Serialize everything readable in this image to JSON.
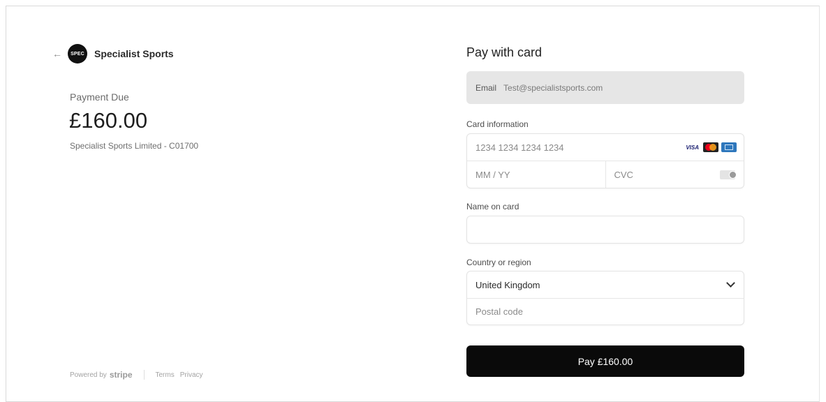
{
  "merchant": {
    "name": "Specialist Sports",
    "logo_text": "SPEC"
  },
  "summary": {
    "due_label": "Payment Due",
    "amount": "£160.00",
    "description": "Specialist Sports Limited - C01700"
  },
  "footer": {
    "powered_by": "Powered by",
    "brand": "stripe",
    "terms": "Terms",
    "privacy": "Privacy"
  },
  "form": {
    "title": "Pay with card",
    "email_label": "Email",
    "email_value": "Test@specialistsports.com",
    "card_label": "Card information",
    "card_number_placeholder": "1234 1234 1234 1234",
    "card_brand_visa": "VISA",
    "expiry_placeholder": "MM / YY",
    "cvc_placeholder": "CVC",
    "name_label": "Name on card",
    "name_value": "",
    "country_label": "Country or region",
    "country_value": "United Kingdom",
    "postal_placeholder": "Postal code",
    "pay_label": "Pay £160.00"
  },
  "colors": {
    "button_bg": "#0a0a0a",
    "email_bg": "#e6e6e6"
  }
}
